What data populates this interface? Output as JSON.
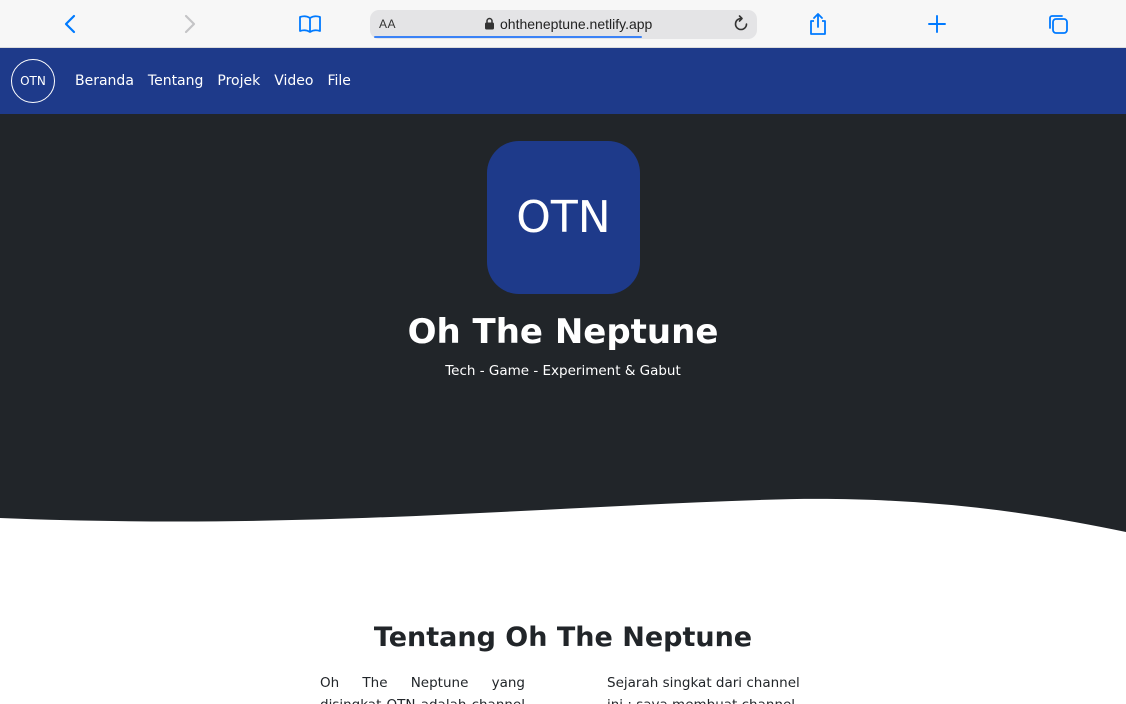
{
  "browser": {
    "url_aa": "AA",
    "url": "ohtheneptune.netlify.app"
  },
  "nav": {
    "logo_text": "OTN",
    "links": [
      "Beranda",
      "Tentang",
      "Projek",
      "Video",
      "File"
    ]
  },
  "hero": {
    "logo_text": "OTN",
    "title": "Oh The Neptune",
    "subtitle": "Tech - Game - Experiment & Gabut"
  },
  "about": {
    "title": "Tentang Oh The Neptune",
    "left_text": "Oh The Neptune yang disingkat OTN adalah channel gabut",
    "right_text": "Sejarah singkat dari channel ini : saya membuat channel ini tahun"
  },
  "colors": {
    "navbar": "#1e3a8a",
    "hero_bg": "#212529",
    "accent": "#007aff"
  }
}
